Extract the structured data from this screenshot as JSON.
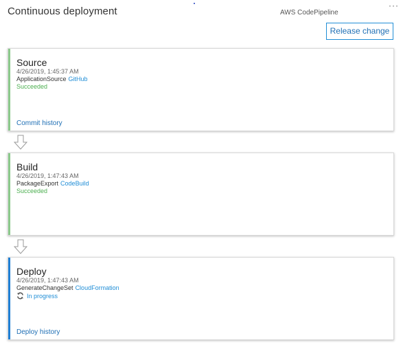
{
  "header": {
    "title": "Continuous deployment",
    "provider": "AWS CodePipeline",
    "more": "···",
    "release_button": "Release change"
  },
  "colors": {
    "succeeded": "#4caf50",
    "in_progress": "#1f8dd6",
    "link": "#1f6fb5"
  },
  "stages": [
    {
      "name": "Source",
      "timestamp": "4/26/2019, 1:45:37 AM",
      "action": "ApplicationSource",
      "provider": "GitHub",
      "status": "Succeeded",
      "status_kind": "succeeded",
      "history_link": "Commit history"
    },
    {
      "name": "Build",
      "timestamp": "4/26/2019, 1:47:43 AM",
      "action": "PackageExport",
      "provider": "CodeBuild",
      "status": "Succeeded",
      "status_kind": "succeeded",
      "history_link": ""
    },
    {
      "name": "Deploy",
      "timestamp": "4/26/2019, 1:47:43 AM",
      "action": "GenerateChangeSet",
      "provider": "CloudFormation",
      "status": "In progress",
      "status_kind": "in-progress",
      "history_link": "Deploy history"
    }
  ]
}
